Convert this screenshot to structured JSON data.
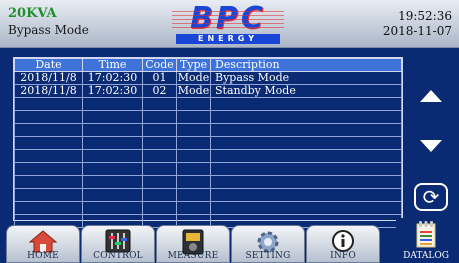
{
  "header": {
    "rating": "20KVA",
    "mode": "Bypass Mode",
    "time": "19:52:36",
    "date": "2018-11-07",
    "logo": {
      "text": "BPC",
      "sub": "ENERGY"
    }
  },
  "log": {
    "columns": [
      "Date",
      "Time",
      "Code",
      "Type",
      "Description"
    ],
    "rows": [
      {
        "date": "2018/11/8",
        "time": "17:02:30",
        "code": "01",
        "type": "Mode",
        "description": "Bypass Mode"
      },
      {
        "date": "2018/11/8",
        "time": "17:02:30",
        "code": "02",
        "type": "Mode",
        "description": "Standby Mode"
      }
    ],
    "empty_rows": 10
  },
  "side": {
    "up": "arrow-up-icon",
    "down": "arrow-down-icon",
    "refresh": "refresh-icon"
  },
  "nav": {
    "home": "HOME",
    "control": "CONTROL",
    "measure": "MEASURE",
    "setting": "SETTING",
    "info": "INFO",
    "datalog": "DATALOG"
  }
}
